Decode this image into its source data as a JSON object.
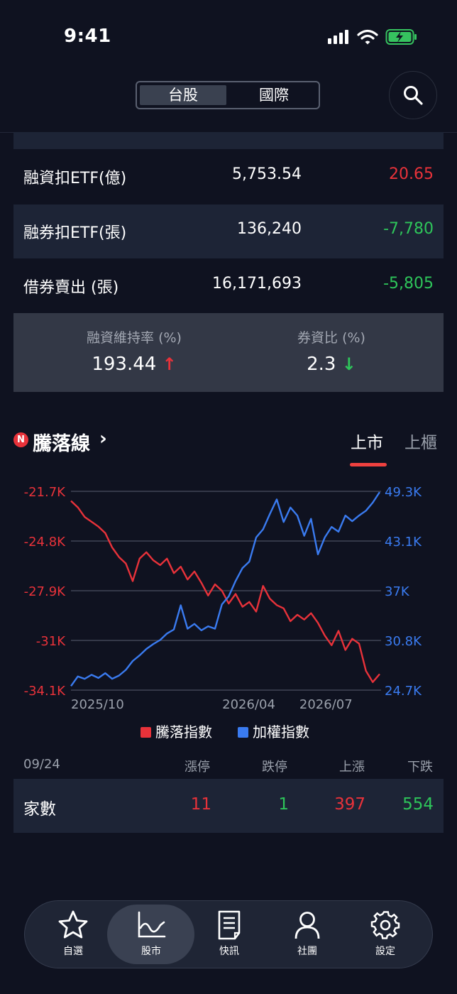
{
  "status_bar": {
    "time": "9:41"
  },
  "top_tabs": [
    "台股",
    "國際"
  ],
  "rows": [
    {
      "label": "融資扣ETF(億)",
      "value": "5,753.54",
      "change": "20.65",
      "change_color": "#e8323a"
    },
    {
      "label": "融券扣ETF(張)",
      "value": "136,240",
      "change": "-7,780",
      "change_color": "#2ec55a"
    },
    {
      "label": "借券賣出 (張)",
      "value": "16,171,693",
      "change": "-5,805",
      "change_color": "#2ec55a"
    }
  ],
  "ratios": {
    "margin_maintenance": {
      "label": "融資維持率 (%)",
      "value": "193.44",
      "direction": "up"
    },
    "short_margin_ratio": {
      "label": "券資比 (%)",
      "value": "2.3",
      "direction": "down"
    }
  },
  "section": {
    "badge": "N",
    "title": "騰落線",
    "chevron": "›",
    "tabs": [
      "上市",
      "上櫃"
    ]
  },
  "chart_data": {
    "type": "line",
    "x_ticks": [
      "2025/10",
      "2026/04",
      "2026/07"
    ],
    "series": [
      {
        "name": "騰落指數",
        "color": "#e8323a",
        "axis": "left",
        "y_ticks": [
          "-21.7K",
          "-24.8K",
          "-27.9K",
          "-31K",
          "-34.1K"
        ],
        "ylim": [
          -34100,
          -21700
        ],
        "values": [
          -22300,
          -22700,
          -23300,
          -23600,
          -23900,
          -24300,
          -25200,
          -25800,
          -26200,
          -27300,
          -25900,
          -25500,
          -26000,
          -26300,
          -25900,
          -26800,
          -26400,
          -27200,
          -26700,
          -27400,
          -28200,
          -27500,
          -27900,
          -28700,
          -28100,
          -28900,
          -28600,
          -29200,
          -27600,
          -28400,
          -28800,
          -29000,
          -29800,
          -29400,
          -29700,
          -29300,
          -29900,
          -30700,
          -31300,
          -30400,
          -31600,
          -30900,
          -31200,
          -32900,
          -33600,
          -33100
        ]
      },
      {
        "name": "加權指數",
        "color": "#3a7bf0",
        "axis": "right",
        "y_ticks": [
          "49.3K",
          "43.1K",
          "37K",
          "30.8K",
          "24.7K"
        ],
        "ylim": [
          24700,
          49300
        ],
        "values": [
          25200,
          26400,
          26100,
          26600,
          26200,
          26800,
          26100,
          26500,
          27200,
          28300,
          29000,
          29800,
          30400,
          30900,
          31700,
          32200,
          35200,
          32300,
          32900,
          32100,
          32600,
          32300,
          35300,
          36300,
          38200,
          39800,
          40600,
          43600,
          44600,
          46500,
          48300,
          45500,
          47300,
          46300,
          43800,
          45900,
          41500,
          43600,
          44900,
          44300,
          46300,
          45600,
          46300,
          46900,
          47900,
          49200
        ]
      }
    ],
    "grid": true
  },
  "stats": {
    "date": "09/24",
    "headers": [
      "漲停",
      "跌停",
      "上漲",
      "下跌"
    ],
    "row_label": "家數",
    "values": [
      {
        "v": "11",
        "color": "#e8323a"
      },
      {
        "v": "1",
        "color": "#2ec55a"
      },
      {
        "v": "397",
        "color": "#e8323a"
      },
      {
        "v": "554",
        "color": "#2ec55a"
      }
    ]
  },
  "nav": [
    {
      "label": "自選",
      "icon": "star-icon"
    },
    {
      "label": "股市",
      "icon": "chart-icon",
      "active": true
    },
    {
      "label": "快訊",
      "icon": "document-icon"
    },
    {
      "label": "社團",
      "icon": "person-icon"
    },
    {
      "label": "設定",
      "icon": "gear-icon"
    }
  ],
  "colors": {
    "up": "#e8323a",
    "down": "#2ec55a",
    "accent_blue": "#3a7bf0",
    "background": "#0f1220",
    "row_shade": "#1d2436"
  }
}
